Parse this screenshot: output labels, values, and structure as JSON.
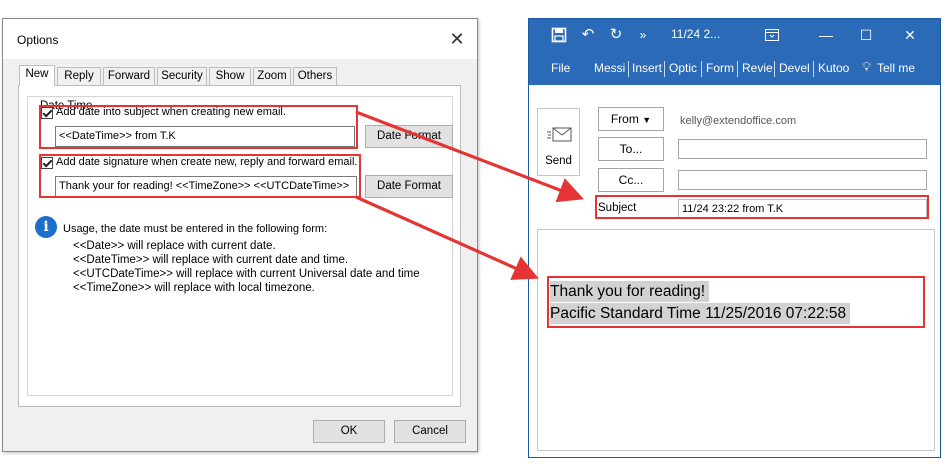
{
  "options_dialog": {
    "title": "Options",
    "close_glyph": "✕",
    "tabs": [
      "New",
      "Reply",
      "Forward",
      "Security",
      "Show",
      "Zoom",
      "Others"
    ],
    "active_tab": "New",
    "group_label": "Date Time",
    "subject_option": {
      "checked": true,
      "label": "Add date into subject when creating new email.",
      "value": "<<DateTime>> from T.K",
      "button": "Date Format"
    },
    "signature_option": {
      "checked": true,
      "label": "Add date signature when create new, reply and forward email.",
      "value": "Thank your for reading!  <<TimeZone>> <<UTCDateTime>>",
      "button": "Date Format"
    },
    "usage": {
      "intro": "Usage, the date must be entered in the following form:",
      "lines": [
        "<<Date>> will replace with current date.",
        "<<DateTime>> will replace with current date and time.",
        "<<UTCDateTime>> will replace with current Universal date and time",
        "<<TimeZone>> will replace with local timezone."
      ]
    },
    "ok_button": "OK",
    "cancel_button": "Cancel"
  },
  "outlook": {
    "title": "11/24 2...",
    "ribbon_tabs": [
      "File",
      "Messi",
      "Insert",
      "Optic",
      "Form",
      "Revie",
      "Devel",
      "Kutoo"
    ],
    "tell_me": "Tell me",
    "send_label": "Send",
    "from_button": "From",
    "from_value": "kelly@extendoffice.com",
    "to_button": "To...",
    "cc_button": "Cc...",
    "subject_label": "Subject",
    "subject_value": "11/24 23:22 from T.K",
    "body_lines": [
      "Thank you for reading!",
      "Pacific Standard Time 11/25/2016 07:22:58"
    ]
  },
  "colors": {
    "outlook_blue": "#2b6ab6",
    "highlight_red": "#e53434",
    "info_blue": "#1e6fcc"
  }
}
